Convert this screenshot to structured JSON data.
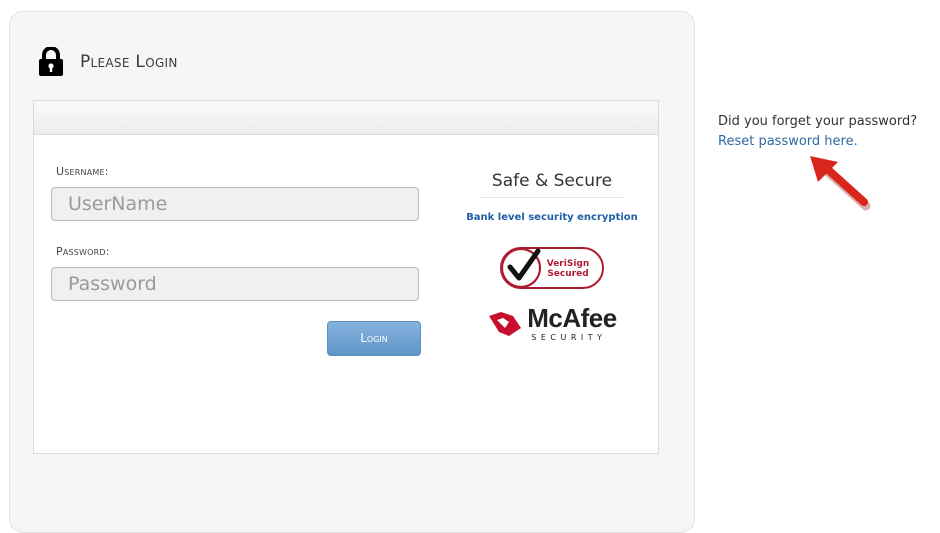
{
  "panel": {
    "title": "Please Login"
  },
  "form": {
    "username_label": "Username:",
    "username_placeholder": "UserName",
    "username_value": "",
    "password_label": "Password:",
    "password_placeholder": "Password",
    "password_value": "",
    "login_label": "Login"
  },
  "trust": {
    "title": "Safe & Secure",
    "subtitle": "Bank level security encryption",
    "verisign_line1": "VeriSign",
    "verisign_line2": "Secured",
    "mcafee_name": "McAfee",
    "mcafee_sub": "SECURITY"
  },
  "side": {
    "question": "Did you forget your password?",
    "reset_link": "Reset password here."
  },
  "colors": {
    "button": "#6fa2d4",
    "link": "#2e6aa0",
    "arrow": "#d9261c",
    "verisign": "#b01c35",
    "mcafee": "#c8102e"
  },
  "icons": [
    "lock-icon",
    "verisign-logo",
    "mcafee-logo",
    "red-arrow-icon"
  ]
}
